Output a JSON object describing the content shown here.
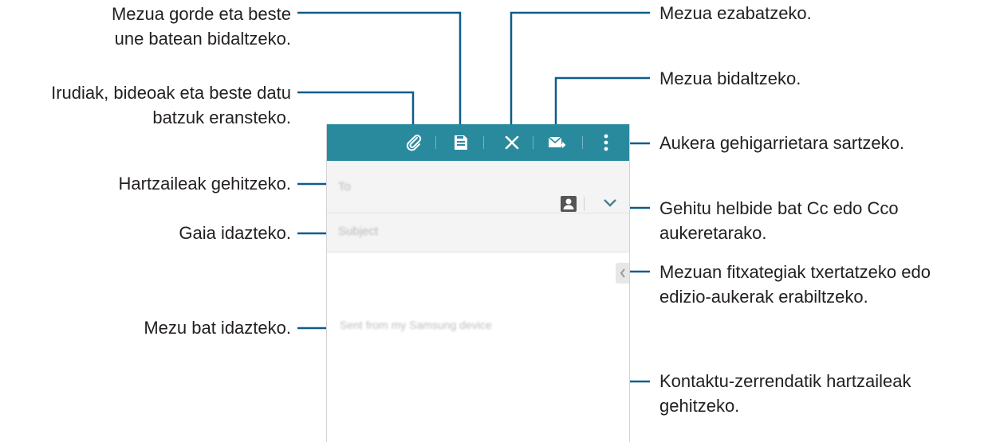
{
  "callouts": {
    "save_draft": "Mezua gorde eta beste\nune batean bidaltzeko.",
    "attach": "Irudiak, bideoak eta beste datu\nbatzuk eransteko.",
    "recipients": "Hartzaileak gehitzeko.",
    "subject": "Gaia idazteko.",
    "compose": "Mezu bat idazteko.",
    "delete": "Mezua ezabatzeko.",
    "send": "Mezua bidaltzeko.",
    "more_options": "Aukera gehigarrietara sartzeko.",
    "cc_bcc": "Gehitu helbide bat Cc edo Cco\naukeretarako.",
    "side_panel": "Mezuan fitxategiak txertatzeko edo\nedizio-aukerak erabiltzeko.",
    "contacts": "Kontaktu-zerrendatik hartzaileak\ngehitzeko."
  },
  "screen": {
    "to_placeholder": "To",
    "subject_placeholder": "Subject",
    "signature": "Sent from my Samsung device"
  },
  "icons": [
    "attach-icon",
    "save-icon",
    "delete-icon",
    "send-icon",
    "more-options-icon",
    "contact-icon",
    "chevron-down-icon",
    "chevron-left-icon"
  ],
  "colors": {
    "toolbar": "#2a8a9d",
    "callout_line": "#0d5c8a",
    "text": "#231f20"
  }
}
